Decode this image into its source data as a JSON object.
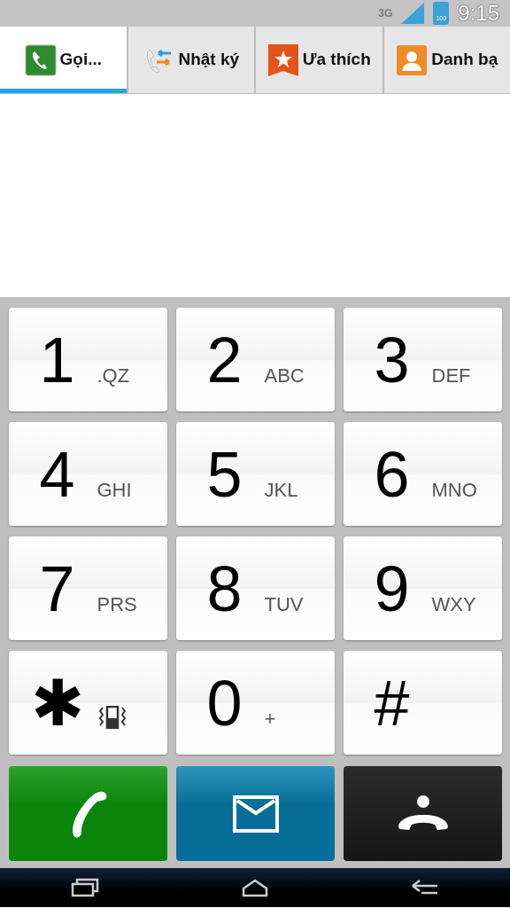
{
  "status_bar": {
    "network": "3G",
    "battery": "100",
    "time": "9:15"
  },
  "tabs": [
    {
      "label": "Gọi...",
      "kind": "phone",
      "selected": true
    },
    {
      "label": "Nhật ký",
      "kind": "log",
      "selected": false
    },
    {
      "label": "Ưa thích",
      "kind": "star",
      "selected": false
    },
    {
      "label": "Danh bạ",
      "kind": "contact",
      "selected": false
    }
  ],
  "keypad": [
    {
      "kind": "letters",
      "digit": "1",
      "letters": ".QZ"
    },
    {
      "kind": "letters",
      "digit": "2",
      "letters": "ABC"
    },
    {
      "kind": "letters",
      "digit": "3",
      "letters": "DEF"
    },
    {
      "kind": "letters",
      "digit": "4",
      "letters": "GHI"
    },
    {
      "kind": "letters",
      "digit": "5",
      "letters": "JKL"
    },
    {
      "kind": "letters",
      "digit": "6",
      "letters": "MNO"
    },
    {
      "kind": "letters",
      "digit": "7",
      "letters": "PRS"
    },
    {
      "kind": "letters",
      "digit": "8",
      "letters": "TUV"
    },
    {
      "kind": "letters",
      "digit": "9",
      "letters": "WXY"
    },
    {
      "kind": "vibrate",
      "digit": "✱"
    },
    {
      "kind": "letters",
      "digit": "0",
      "letters": "+"
    },
    {
      "kind": "plain",
      "digit": "#"
    }
  ],
  "actions": [
    {
      "kind": "call"
    },
    {
      "kind": "message"
    },
    {
      "kind": "end"
    }
  ]
}
